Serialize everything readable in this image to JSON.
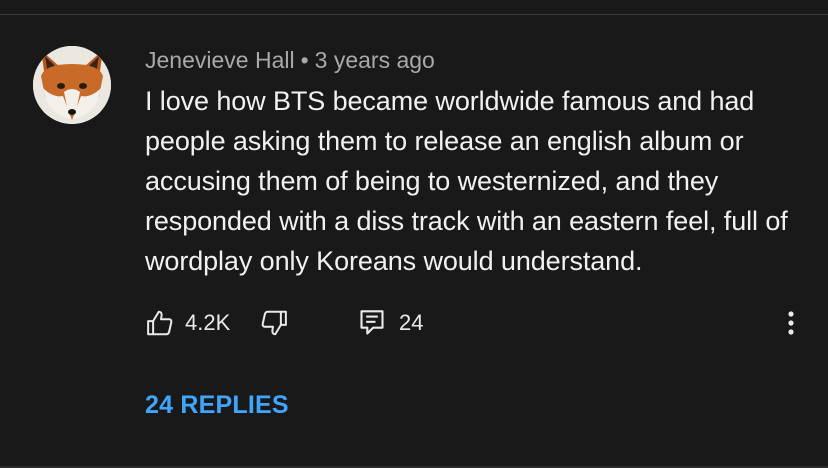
{
  "comment": {
    "author": "Jenevieve Hall",
    "separator": "•",
    "timestamp": "3 years ago",
    "text": "I love how BTS became worldwide famous and had people asking them to release an english album or accusing them of being to westernized, and they responded with a diss track with an eastern feel, full of wordplay only Koreans would understand.",
    "avatar_icon": "fox-avatar"
  },
  "actions": {
    "like_icon": "thumbs-up-icon",
    "like_count": "4.2K",
    "dislike_icon": "thumbs-down-icon",
    "reply_icon": "comment-icon",
    "reply_count": "24",
    "more_icon": "vertical-dots-icon"
  },
  "replies": {
    "label": "24 REPLIES"
  },
  "colors": {
    "background": "#191919",
    "text_primary": "#f1f1f1",
    "text_secondary": "#a9a9a9",
    "link": "#3ea6ff"
  }
}
